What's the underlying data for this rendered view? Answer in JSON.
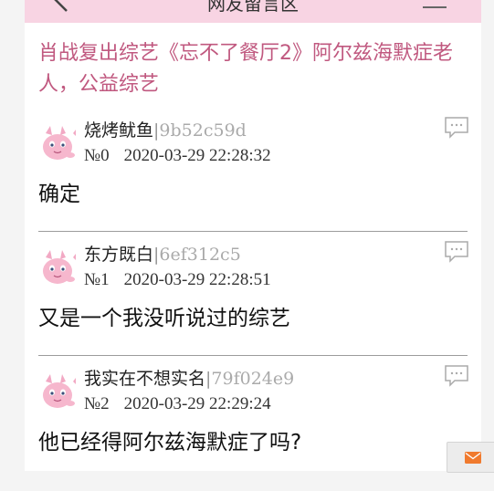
{
  "header": {
    "title": "网友留言区"
  },
  "thread": {
    "title": "肖战复出综艺《忘不了餐厅2》阿尔兹海默症老人，公益综艺"
  },
  "posts": [
    {
      "author": "烧烤鱿鱼",
      "separator": "|",
      "uid": "9b52c59d",
      "number": "№0",
      "datetime": "2020-03-29 22:28:32",
      "content": "确定"
    },
    {
      "author": "东方既白",
      "separator": "|",
      "uid": "6ef312c5",
      "number": "№1",
      "datetime": "2020-03-29 22:28:51",
      "content": "又是一个我没听说过的综艺"
    },
    {
      "author": "我实在不想实名",
      "separator": "|",
      "uid": "79f024e9",
      "number": "№2",
      "datetime": "2020-03-29 22:29:24",
      "content": "他已经得阿尔兹海默症了吗?"
    }
  ],
  "icons": {
    "back": "back-arrow-icon",
    "menu": "hamburger-menu-icon",
    "reply": "speech-bubble-icon",
    "avatar": "pink-creature-icon",
    "mail": "mail-icon"
  },
  "colors": {
    "header_bg": "#f8d4e3",
    "title_pink": "#c0587f",
    "uid_gray": "#aaaaaa",
    "mail_orange": "#f07a2e"
  }
}
